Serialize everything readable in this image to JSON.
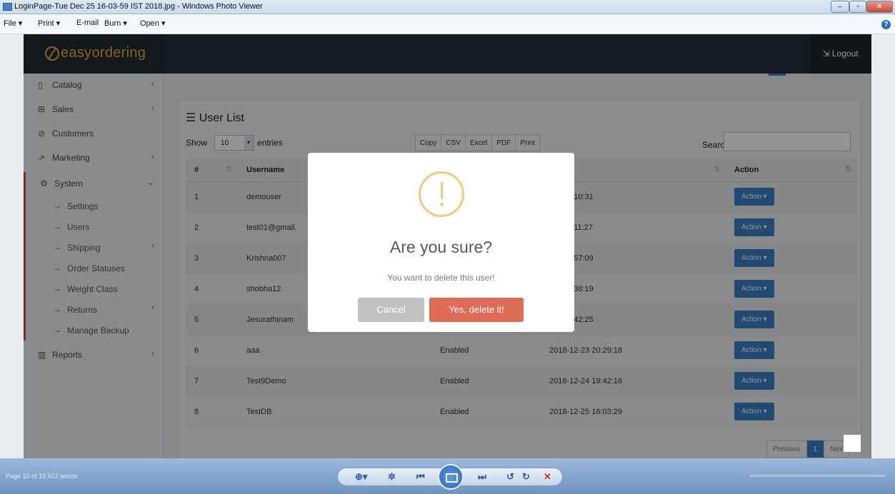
{
  "window": {
    "title": "LoginPage-Tue Dec 25 16-03-59 IST 2018.jpg - Windows Photo Viewer"
  },
  "menu": [
    "File ▾",
    "Print ▾",
    "E-mail",
    "Burn ▾",
    "Open ▾"
  ],
  "app": {
    "brand": "easyordering",
    "logout": "⇲ Logout",
    "accent": "#f1a53b"
  },
  "sidebar": {
    "items": [
      {
        "icon": "catalog-icon",
        "glyph": "▯",
        "label": "Catalog",
        "chev": "‹"
      },
      {
        "icon": "cart-icon",
        "glyph": "⊞",
        "label": "Sales",
        "chev": "‹"
      },
      {
        "icon": "user-icon",
        "glyph": "⊘",
        "label": "Customers",
        "chev": ""
      },
      {
        "icon": "marketing-icon",
        "glyph": "⇗",
        "label": "Marketing",
        "chev": "‹"
      },
      {
        "icon": "gear-icon",
        "glyph": "⚙",
        "label": "System",
        "chev": "⌄"
      }
    ],
    "sub": [
      {
        "label": "Settings",
        "chev": ""
      },
      {
        "label": "Users",
        "chev": ""
      },
      {
        "label": "Shipping",
        "chev": "‹"
      },
      {
        "label": "Order Statuses",
        "chev": ""
      },
      {
        "label": "Weight Class",
        "chev": ""
      },
      {
        "label": "Returns",
        "chev": "‹"
      },
      {
        "label": "Manage Backup",
        "chev": ""
      }
    ],
    "reports": {
      "label": "Reports",
      "chev": "‹"
    }
  },
  "panel": {
    "title": "☰ User List",
    "show": "Show",
    "length": "10",
    "entries": "entries",
    "search": "Search:"
  },
  "buttons": [
    "Copy",
    "CSV",
    "Excel",
    "PDF",
    "Print"
  ],
  "table": {
    "headers": [
      "#",
      "Username",
      "",
      "dded",
      "Action"
    ],
    "rows": [
      [
        "1",
        "demouser",
        "",
        "-10 18:10:31"
      ],
      [
        "2",
        "test01@gmail.",
        "",
        "-17 21:11:27"
      ],
      [
        "3",
        "Krishna007",
        "",
        "-18 21:57:09"
      ],
      [
        "4",
        "shobha12",
        "",
        "-20 10:38:19"
      ],
      [
        "5",
        "Jesurathinam",
        "",
        "-21 16:42:25"
      ],
      [
        "6",
        "aaa",
        "Enabled",
        "2018-12-23 20:29:18"
      ],
      [
        "7",
        "Test9Demo",
        "Enabled",
        "2018-12-24 19:42:16"
      ],
      [
        "8",
        "TestDB",
        "Enabled",
        "2018-12-25 16:03:29"
      ]
    ],
    "action_label": "Action ▾"
  },
  "pager": {
    "prev": "Previous",
    "current": "1",
    "next": "Nex"
  },
  "modal": {
    "title": "Are you sure?",
    "text": "You want to delete this user!",
    "cancel": "Cancel",
    "confirm": "Yes, delete it!"
  },
  "viewer": {
    "status": "Page 10 of 10   922 words"
  }
}
